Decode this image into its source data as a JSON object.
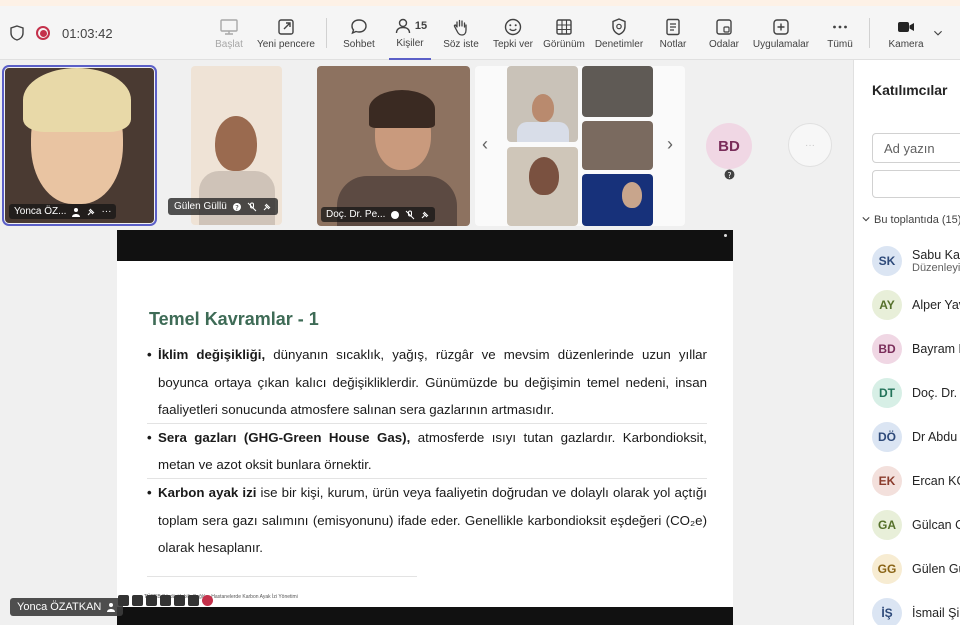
{
  "recording": {
    "timer": "01:03:42"
  },
  "toolbar": {
    "items": [
      {
        "key": "baslat",
        "label": "Başlat"
      },
      {
        "key": "yeni_pencere",
        "label": "Yeni pencere"
      },
      {
        "key": "sohbet",
        "label": "Sohbet"
      },
      {
        "key": "kisiler",
        "label": "Kişiler",
        "count": "15"
      },
      {
        "key": "soz_iste",
        "label": "Söz iste"
      },
      {
        "key": "tepki_ver",
        "label": "Tepki ver"
      },
      {
        "key": "gorunum",
        "label": "Görünüm"
      },
      {
        "key": "denetimler",
        "label": "Denetimler"
      },
      {
        "key": "notlar",
        "label": "Notlar"
      },
      {
        "key": "odalar",
        "label": "Odalar"
      },
      {
        "key": "uygulamalar",
        "label": "Uygulamalar"
      },
      {
        "key": "tumu",
        "label": "Tümü"
      },
      {
        "key": "kamera",
        "label": "Kamera"
      }
    ]
  },
  "gallery": {
    "tiles": [
      {
        "name": "Yonca ÖZ..."
      },
      {
        "name": "Gülen Güllü"
      },
      {
        "name": "Doç. Dr. Pe..."
      }
    ],
    "overflow_avatar": "BD",
    "more_label": "···"
  },
  "slide": {
    "title": "Temel Kavramlar - 1",
    "bullets": [
      {
        "bold": "İklim değişikliği,",
        "text": " dünyanın sıcaklık, yağış, rüzgâr ve mevsim düzenlerinde uzun yıllar boyunca ortaya çıkan kalıcı değişikliklerdir. Günümüzde bu değişimin temel nedeni, insan faaliyetleri sonucunda atmosfere salınan sera gazlarının artmasıdır."
      },
      {
        "bold": "Sera gazları (GHG-Green House Gas),",
        "text": " atmosferde ısıyı tutan gazlardır. Karbondioksit, metan ve azot oksit bunlara örnektir."
      },
      {
        "bold": "Karbon ayak izi",
        "text": " ise bir kişi, kurum, ürün veya faaliyetin doğrudan ve dolaylı olarak yol açtığı toplam sera gazı salımını (emisyonunu) ifade eder. Genellikle karbondioksit eşdeğeri (CO₂e) olarak hesaplanır."
      }
    ],
    "footer": "TÜSEB Sürdürülebilir Sağlık · Hastanelerde Karbon Ayak İzi Yönetimi"
  },
  "presenter": {
    "name": "Yonca ÖZATKAN"
  },
  "panel": {
    "title": "Katılımcılar",
    "search_placeholder": "Ad yazın",
    "section": "Bu toplantıda (15)",
    "participants": [
      {
        "initials": "SK",
        "name": "Sabu Kar",
        "sub": "Düzenleyi",
        "bg": "#dbe5f3",
        "fg": "#2e4a7a"
      },
      {
        "initials": "AY",
        "name": "Alper Yav",
        "sub": "",
        "bg": "#e8efd9",
        "fg": "#55702a"
      },
      {
        "initials": "BD",
        "name": "Bayram D",
        "sub": "",
        "bg": "#f0d7e4",
        "fg": "#7a2d5a"
      },
      {
        "initials": "DT",
        "name": "Doç. Dr.",
        "sub": "",
        "bg": "#d7efe6",
        "fg": "#23735a"
      },
      {
        "initials": "DÖ",
        "name": "Dr Abdu",
        "sub": "",
        "bg": "#dbe5f3",
        "fg": "#2e4a7a"
      },
      {
        "initials": "EK",
        "name": "Ercan KO",
        "sub": "",
        "bg": "#f3e0dc",
        "fg": "#8a3b2c"
      },
      {
        "initials": "GA",
        "name": "Gülcan O",
        "sub": "",
        "bg": "#e8efd9",
        "fg": "#55702a"
      },
      {
        "initials": "GG",
        "name": "Gülen Gü",
        "sub": "",
        "bg": "#f7ecd2",
        "fg": "#8a6416"
      },
      {
        "initials": "İŞ",
        "name": "İsmail Şi",
        "sub": "",
        "bg": "#dbe5f3",
        "fg": "#2e4a7a"
      }
    ]
  }
}
